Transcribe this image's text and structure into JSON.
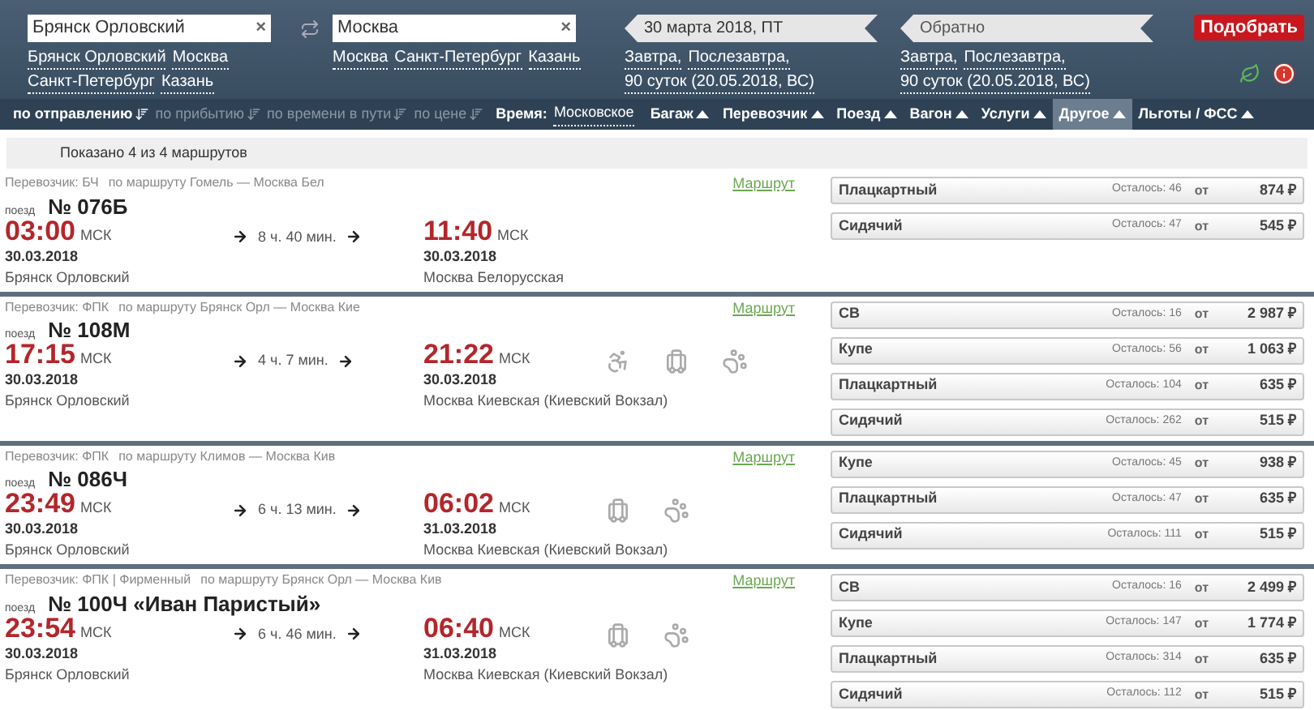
{
  "search": {
    "from": {
      "value": "Брянск Орловский",
      "clear": "×",
      "suggestions": [
        "Брянск Орловский",
        "Москва",
        "Санкт-Петербург",
        "Казань"
      ]
    },
    "to": {
      "value": "Москва",
      "clear": "×",
      "suggestions": [
        "Москва",
        "Санкт-Петербург",
        "Казань"
      ]
    },
    "date": {
      "value": "30 марта 2018, ПТ",
      "shortcuts": [
        "Завтра,",
        "Послезавтра,",
        "90 суток (20.05.2018, ВС)"
      ]
    },
    "return_date": {
      "placeholder": "Обратно",
      "shortcuts": [
        "Завтра,",
        "Послезавтра,",
        "90 суток (20.05.2018, ВС)"
      ]
    },
    "submit": "Подобрать"
  },
  "sort": [
    {
      "label": "по отправлению",
      "selected": true
    },
    {
      "label": "по прибытию",
      "selected": false
    },
    {
      "label": "по времени в пути",
      "selected": false
    },
    {
      "label": "по цене",
      "selected": false
    }
  ],
  "time": {
    "label": "Время:",
    "value": "Московское"
  },
  "filters": [
    {
      "label": "Багаж",
      "selected": false
    },
    {
      "label": "Перевозчик",
      "selected": false
    },
    {
      "label": "Поезд",
      "selected": false
    },
    {
      "label": "Вагон",
      "selected": false
    },
    {
      "label": "Услуги",
      "selected": false
    },
    {
      "label": "Другое",
      "selected": true
    },
    {
      "label": "Льготы / ФСС",
      "selected": false
    }
  ],
  "summary": "Показано 4 из 4 маршрутов",
  "trains": [
    {
      "carrier": "Перевозчик: БЧ",
      "route": "по маршруту Гомель — Москва Бел",
      "route_link": "Маршрут",
      "train_label": "поезд",
      "number": "№ 076Б",
      "departure": {
        "time": "03:00",
        "zone": "МСК",
        "date": "30.03.2018",
        "station": "Брянск Орловский"
      },
      "duration": "8 ч. 40 мин.",
      "arrival": {
        "time": "11:40",
        "zone": "МСК",
        "date": "30.03.2018",
        "station": "Москва Белорусская"
      },
      "cars": [
        {
          "type": "Плацкартный",
          "remaining": "Осталось: 46",
          "from": "от",
          "price": "874 ₽"
        },
        {
          "type": "Сидячий",
          "remaining": "Осталось: 47",
          "from": "от",
          "price": "545 ₽"
        }
      ]
    },
    {
      "carrier": "Перевозчик: ФПК",
      "route": "по маршруту Брянск Орл — Москва Кие",
      "route_link": "Маршрут",
      "train_label": "поезд",
      "number": "№ 108М",
      "departure": {
        "time": "17:15",
        "zone": "МСК",
        "date": "30.03.2018",
        "station": "Брянск Орловский"
      },
      "duration": "4 ч. 7 мин.",
      "arrival": {
        "time": "21:22",
        "zone": "МСК",
        "date": "30.03.2018",
        "station": "Москва Киевская (Киевский Вокзал)"
      },
      "services": [
        {
          "kind": "wheelchair"
        },
        {
          "kind": "luggage"
        },
        {
          "kind": "pets"
        }
      ],
      "cars": [
        {
          "type": "СВ",
          "remaining": "Осталось: 16",
          "from": "от",
          "price": "2 987 ₽"
        },
        {
          "type": "Купе",
          "remaining": "Осталось: 56",
          "from": "от",
          "price": "1 063 ₽"
        },
        {
          "type": "Плацкартный",
          "remaining": "Осталось: 104",
          "from": "от",
          "price": "635 ₽"
        },
        {
          "type": "Сидячий",
          "remaining": "Осталось: 262",
          "from": "от",
          "price": "515 ₽"
        }
      ]
    },
    {
      "carrier": "Перевозчик: ФПК",
      "route": "по маршруту Климов — Москва Кив",
      "route_link": "Маршрут",
      "train_label": "поезд",
      "number": "№ 086Ч",
      "departure": {
        "time": "23:49",
        "zone": "МСК",
        "date": "30.03.2018",
        "station": "Брянск Орловский"
      },
      "duration": "6 ч. 13 мин.",
      "arrival": {
        "time": "06:02",
        "zone": "МСК",
        "date": "31.03.2018",
        "station": "Москва Киевская (Киевский Вокзал)"
      },
      "services": [
        {
          "kind": "luggage"
        },
        {
          "kind": "pets"
        }
      ],
      "cars": [
        {
          "type": "Купе",
          "remaining": "Осталось: 45",
          "from": "от",
          "price": "938 ₽"
        },
        {
          "type": "Плацкартный",
          "remaining": "Осталось: 47",
          "from": "от",
          "price": "635 ₽"
        },
        {
          "type": "Сидячий",
          "remaining": "Осталось: 111",
          "from": "от",
          "price": "515 ₽"
        }
      ]
    },
    {
      "carrier": "Перевозчик: ФПК | Фирменный",
      "route": "по маршруту Брянск Орл — Москва Кив",
      "route_link": "Маршрут",
      "train_label": "поезд",
      "number": "№ 100Ч «Иван Паристый»",
      "departure": {
        "time": "23:54",
        "zone": "МСК",
        "date": "30.03.2018",
        "station": "Брянск Орловский"
      },
      "duration": "6 ч. 46 мин.",
      "arrival": {
        "time": "06:40",
        "zone": "МСК",
        "date": "31.03.2018",
        "station": "Москва Киевская (Киевский Вокзал)"
      },
      "services": [
        {
          "kind": "luggage"
        },
        {
          "kind": "pets"
        }
      ],
      "cars": [
        {
          "type": "СВ",
          "remaining": "Осталось: 16",
          "from": "от",
          "price": "2 499 ₽"
        },
        {
          "type": "Купе",
          "remaining": "Осталось: 147",
          "from": "от",
          "price": "1 774 ₽"
        },
        {
          "type": "Плацкартный",
          "remaining": "Осталось: 314",
          "from": "от",
          "price": "635 ₽"
        },
        {
          "type": "Сидячий",
          "remaining": "Осталось: 112",
          "from": "от",
          "price": "515 ₽"
        }
      ]
    }
  ]
}
